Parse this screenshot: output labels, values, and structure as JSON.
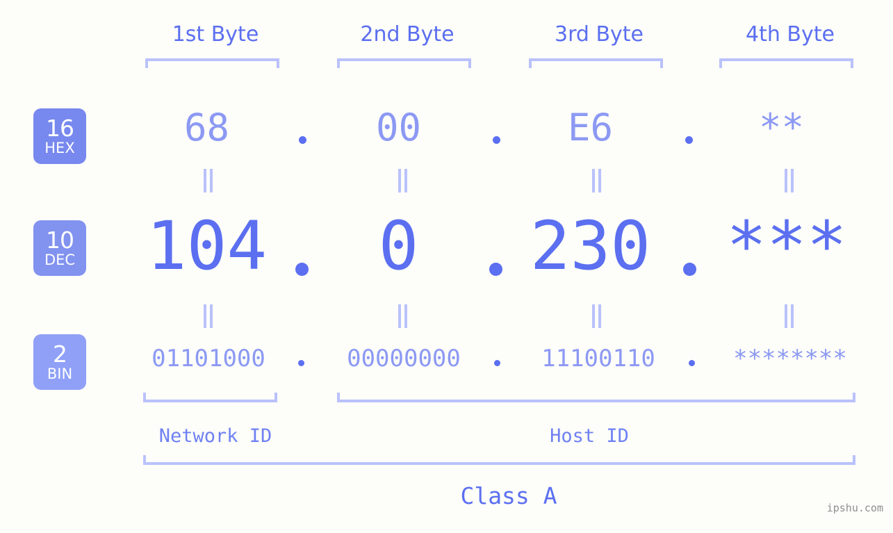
{
  "page": {
    "background": "#fdfdfa",
    "accent": "#5b6ff0",
    "accent_light": "#8c99f3",
    "accent_pale": "#b9c2fb",
    "watermark": "ipshu.com"
  },
  "byte_headers": [
    {
      "label": "1st Byte"
    },
    {
      "label": "2nd Byte"
    },
    {
      "label": "3rd Byte"
    },
    {
      "label": "4th Byte"
    }
  ],
  "rows": [
    {
      "badge_number": "16",
      "badge_label": "HEX",
      "badge_color": "#7788ee",
      "values": [
        "68",
        "00",
        "E6",
        "**"
      ],
      "separators": [
        ".",
        ".",
        "."
      ]
    },
    {
      "badge_number": "10",
      "badge_label": "DEC",
      "badge_color": "#8192ef",
      "values": [
        "104",
        "0",
        "230",
        "***"
      ],
      "separators": [
        ".",
        ".",
        "."
      ]
    },
    {
      "badge_number": "2",
      "badge_label": "BIN",
      "badge_color": "#8fa0f6",
      "values": [
        "01101000",
        "00000000",
        "11100110",
        "********"
      ],
      "separators": [
        ".",
        ".",
        "."
      ]
    }
  ],
  "equals_symbol": "=",
  "footer": {
    "network_id": "Network ID",
    "host_id": "Host ID",
    "class_label": "Class A"
  }
}
